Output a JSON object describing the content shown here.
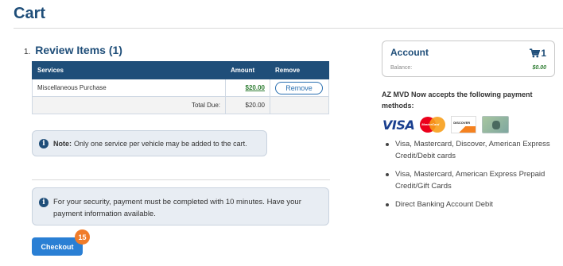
{
  "page": {
    "title": "Cart"
  },
  "review": {
    "number": "1.",
    "heading": "Review Items (1)",
    "columns": {
      "services": "Services",
      "amount": "Amount",
      "remove": "Remove"
    },
    "rows": [
      {
        "service": "Miscellaneous Purchase",
        "amount": "$20.00",
        "remove_label": "Remove"
      }
    ],
    "total_label": "Total Due:",
    "total_value": "$20.00"
  },
  "note": {
    "label": "Note:",
    "text": "Only one service per vehicle may be added to the cart."
  },
  "security": {
    "text": "For your security, payment must be completed with 10 minutes. Have your payment information available."
  },
  "checkout": {
    "label": "Checkout",
    "badge": "15"
  },
  "account": {
    "title": "Account",
    "cart_count": "1",
    "balance_label": "Balance:",
    "balance_value": "$0.00"
  },
  "payment": {
    "heading": "AZ MVD Now accepts the following payment methods:",
    "card_logos": [
      "visa",
      "mastercard",
      "discover",
      "american-express"
    ],
    "visa_text": "VISA",
    "mastercard_text": "MasterCard",
    "discover_text": "DISCOVER",
    "methods": [
      "Visa, Mastercard, Discover, American Express Credit/Debit cards",
      "Visa, Mastercard, American Express Prepaid Credit/Gift Cards",
      "Direct Banking Account Debit"
    ]
  },
  "colors": {
    "primary": "#1f4e79",
    "accent_button": "#2a7fd4",
    "badge": "#f07c2a",
    "amount_green": "#2e7d32"
  }
}
